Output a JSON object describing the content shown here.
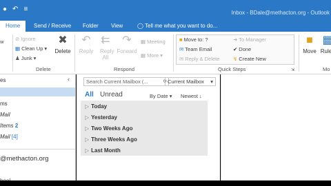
{
  "titlebar": {
    "title": "Inbox - BDale@methacton.org - Outlook"
  },
  "tabs": [
    "Home",
    "Send / Receive",
    "Folder",
    "View",
    "Tell me what you want to do..."
  ],
  "ribbon": {
    "delete_group": {
      "ignore": "Ignore",
      "clean_up": "Clean Up",
      "junk": "Junk",
      "delete": "Delete",
      "label": "Delete"
    },
    "respond_group": {
      "reply": "Reply",
      "reply_all": "Reply All",
      "forward": "Forward",
      "meeting": "Meeting",
      "more": "More",
      "label": "Respond"
    },
    "quick_steps": {
      "items": [
        "Move to: ?",
        "Team Email",
        "Reply & Delete",
        "To Manager",
        "Done",
        "Create New"
      ],
      "label": "Quick Steps"
    },
    "move_group": {
      "move": "Move",
      "rules": "Rules",
      "label": "Mo"
    },
    "new_label": "ew"
  },
  "nav": {
    "items": [
      {
        "label": "es"
      },
      {
        "label": "ms"
      },
      {
        "label": "Mail"
      },
      {
        "label": "Items",
        "count": "2"
      },
      {
        "label": "Mail",
        "count": "[4]"
      },
      {
        "label": "@methacton.org"
      },
      {
        "label": "hool"
      }
    ]
  },
  "list": {
    "search_placeholder": "Search Current Mailbox (...",
    "scope": "Current Mailbox",
    "filter_all": "All",
    "filter_unread": "Unread",
    "sort_by": "By Date",
    "sort_order": "Newest",
    "groups": [
      "Today",
      "Yesterday",
      "Two Weeks Ago",
      "Three Weeks Ago",
      "Last Month"
    ]
  },
  "colors": {
    "accent": "#2b78c6",
    "selected": "#c6dcf3"
  }
}
